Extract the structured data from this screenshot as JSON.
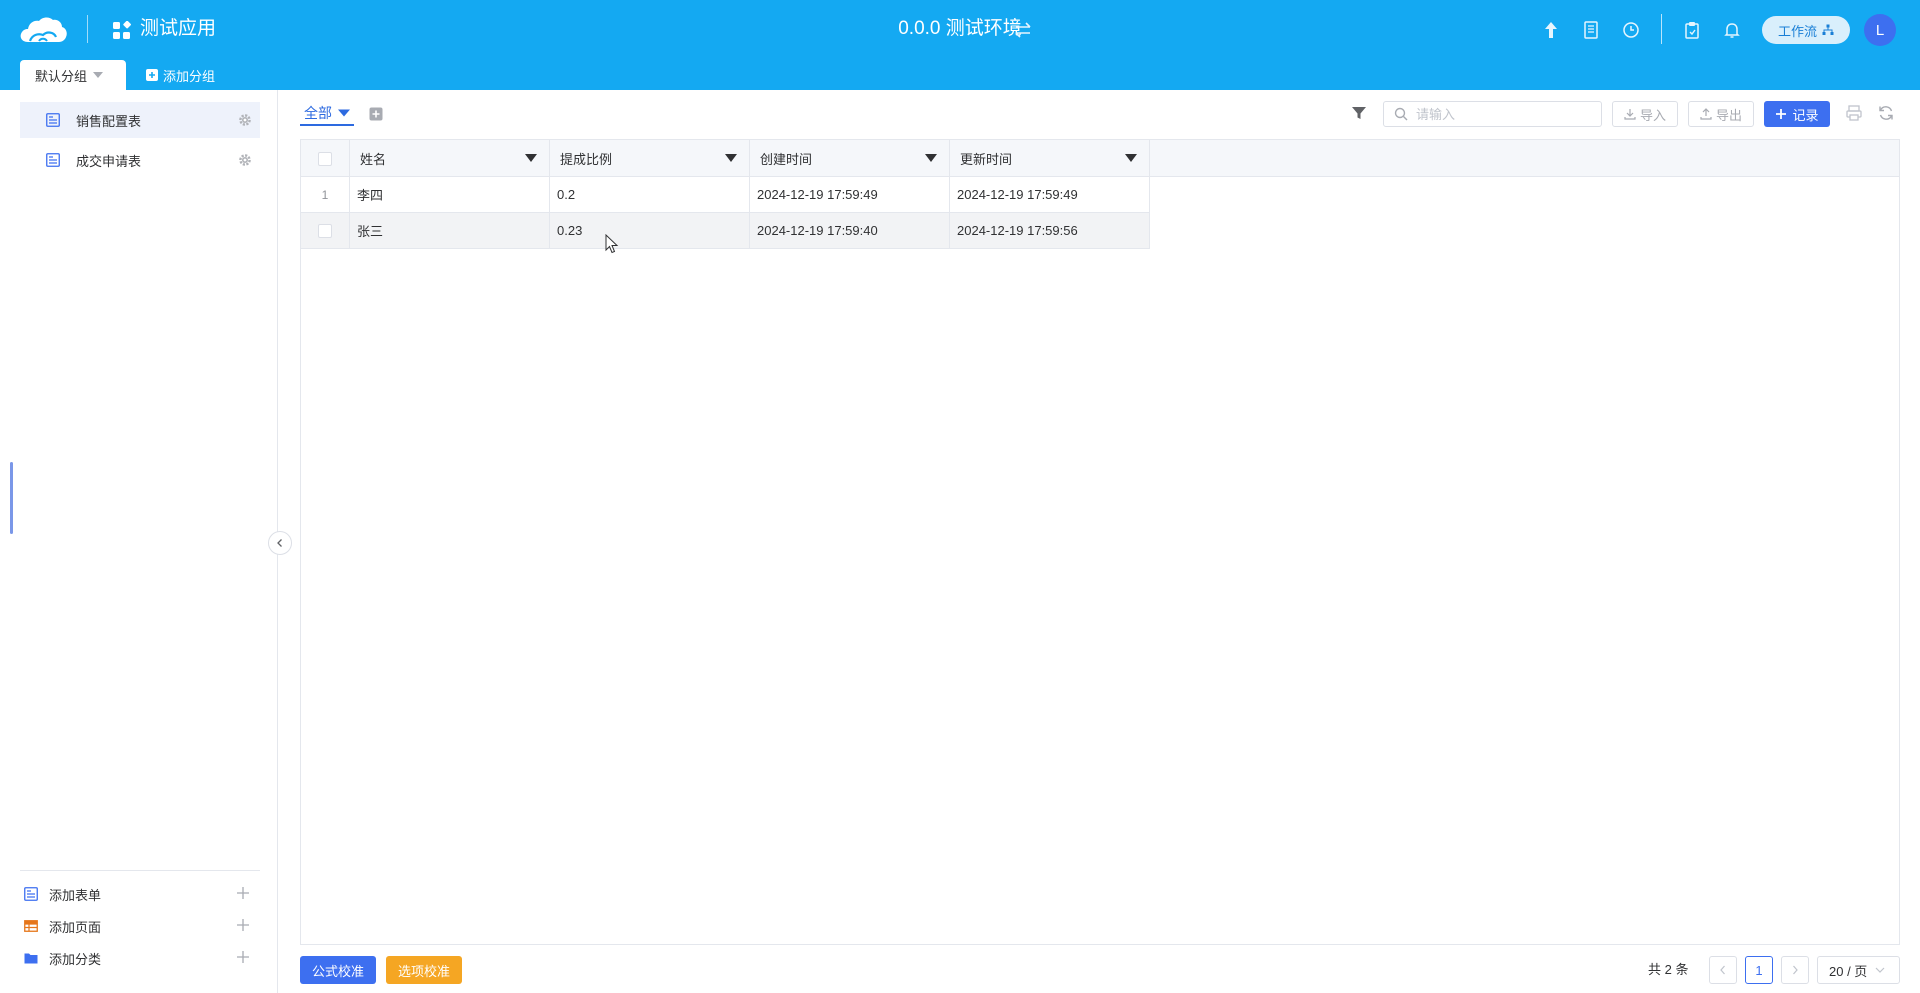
{
  "header": {
    "app_title": "测试应用",
    "env_title": "0.0.0 测试环境",
    "workflow_label": "工作流",
    "avatar_letter": "L",
    "background": "#14a9f2"
  },
  "groups": {
    "active_label": "默认分组",
    "add_label": "添加分组"
  },
  "sidebar": {
    "items": [
      {
        "label": "销售配置表",
        "active": true
      },
      {
        "label": "成交申请表",
        "active": false
      }
    ],
    "bottom": {
      "add_form": "添加表单",
      "add_page": "添加页面",
      "add_category": "添加分类"
    }
  },
  "toolbar": {
    "view_tab": "全部",
    "search_placeholder": "请输入",
    "import_label": "导入",
    "export_label": "导出",
    "record_label": "记录",
    "accent": "#3d6ff0"
  },
  "table": {
    "columns": [
      "姓名",
      "提成比例",
      "创建时间",
      "更新时间"
    ],
    "rows": [
      {
        "index": "1",
        "cells": [
          "李四",
          "0.2",
          "2024-12-19 17:59:49",
          "2024-12-19 17:59:49"
        ]
      },
      {
        "index": "",
        "cells": [
          "张三",
          "0.23",
          "2024-12-19 17:59:40",
          "2024-12-19 17:59:56"
        ]
      }
    ]
  },
  "footer": {
    "formula_btn": "公式校准",
    "option_btn": "选项校准",
    "option_color": "#f5a623",
    "total": "共 2 条",
    "current_page": "1",
    "page_size": "20 / 页"
  }
}
